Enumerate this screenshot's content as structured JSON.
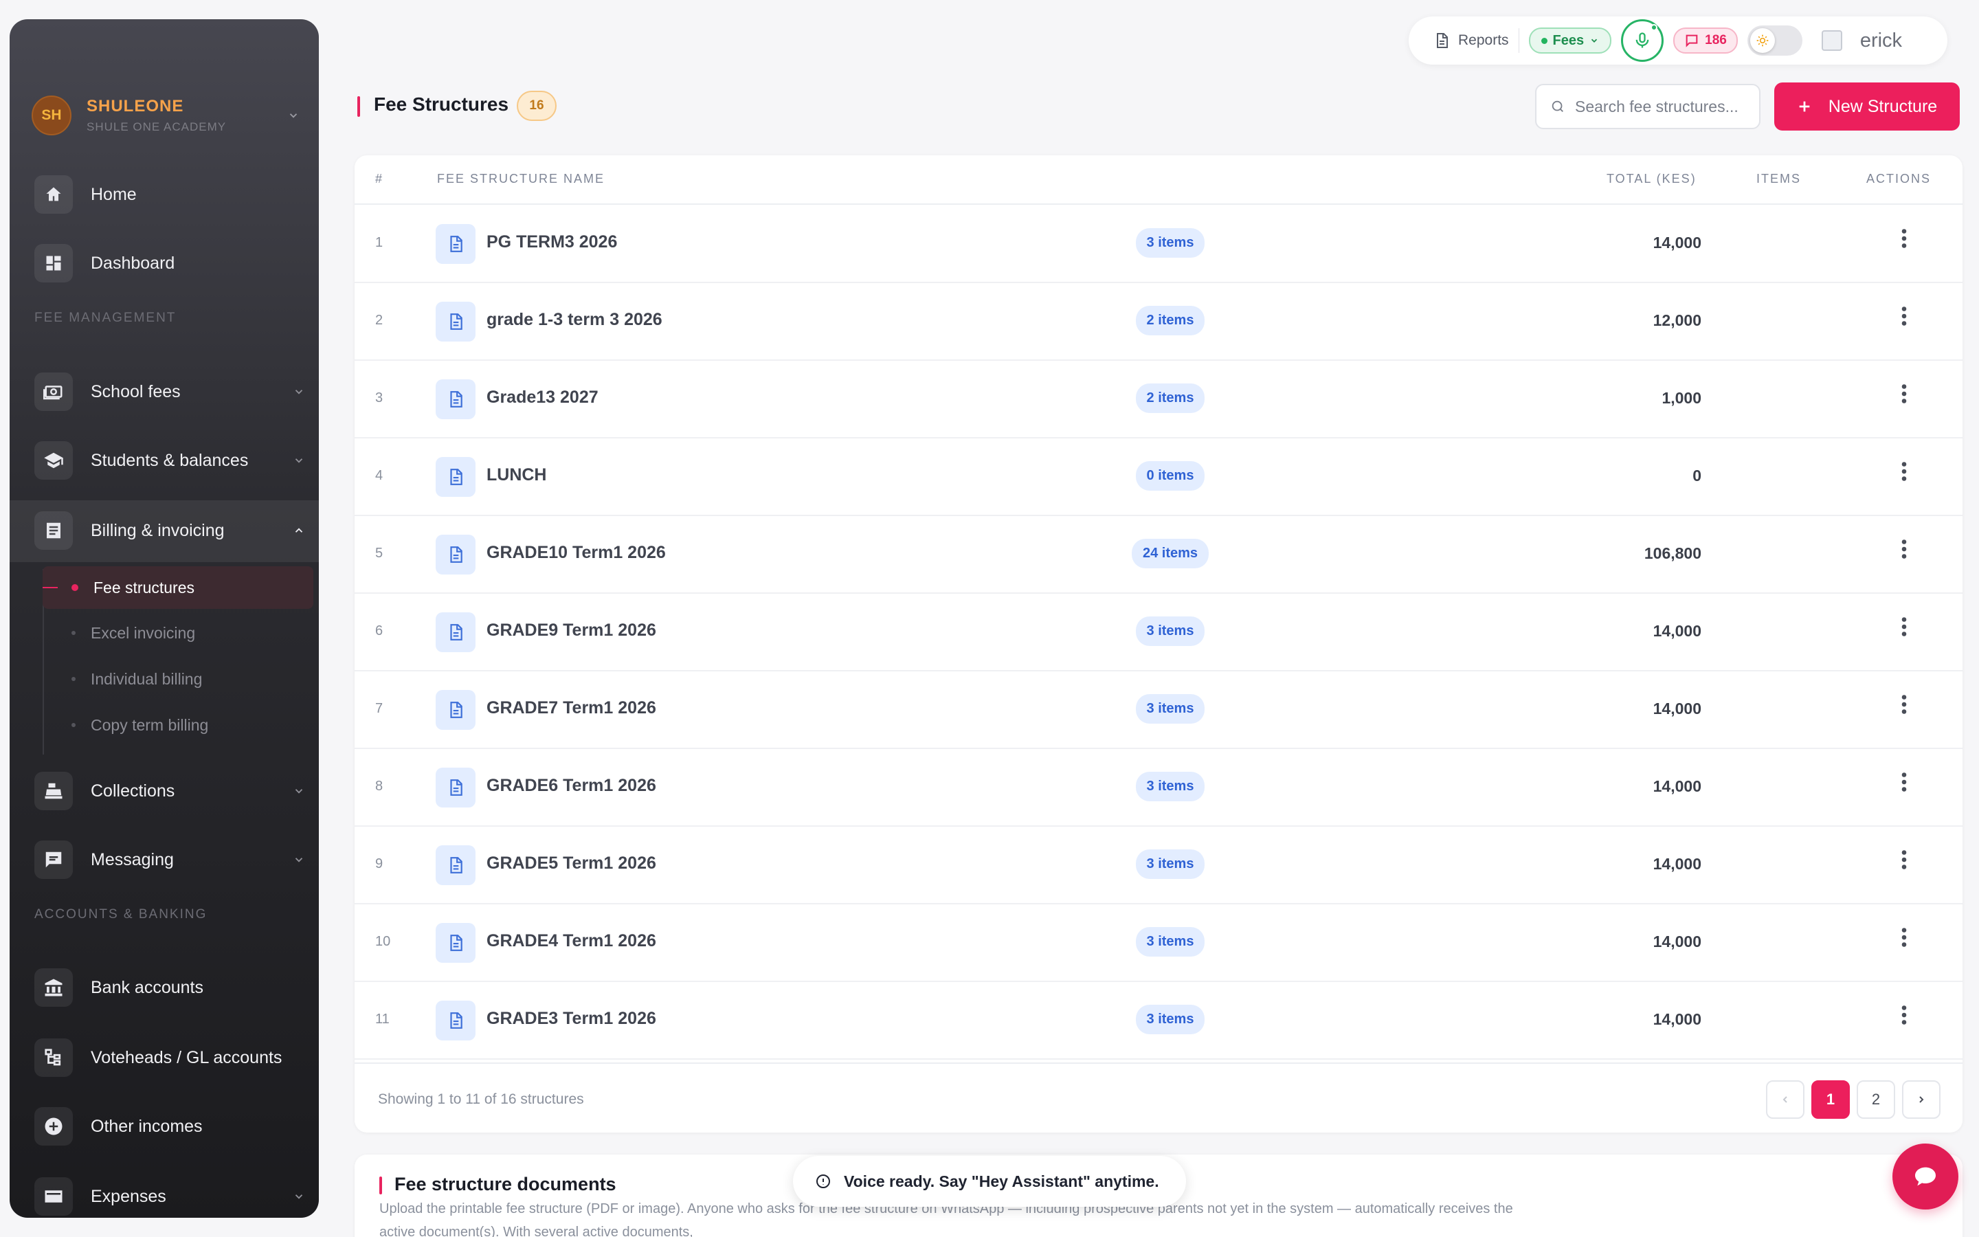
{
  "sidebar": {
    "brand": {
      "initials": "SH",
      "name": "SHULEONE",
      "subtitle": "SHULE ONE ACADEMY"
    },
    "items_top": [
      {
        "label": "Home",
        "icon": "home-icon"
      },
      {
        "label": "Dashboard",
        "icon": "dashboard-icon"
      }
    ],
    "section_fee": "FEE MANAGEMENT",
    "fee_items": [
      {
        "label": "School fees",
        "icon": "money-icon"
      },
      {
        "label": "Students & balances",
        "icon": "graduation-cap-icon"
      },
      {
        "label": "Billing & invoicing",
        "icon": "receipt-icon"
      }
    ],
    "billing_sub": [
      "Fee structures",
      "Excel invoicing",
      "Individual billing",
      "Copy term billing"
    ],
    "fee_items_after": [
      {
        "label": "Collections",
        "icon": "cash-register-icon"
      },
      {
        "label": "Messaging",
        "icon": "message-icon"
      }
    ],
    "section_accounts": "ACCOUNTS & BANKING",
    "account_items": [
      {
        "label": "Bank accounts",
        "icon": "bank-icon"
      },
      {
        "label": "Voteheads / GL accounts",
        "icon": "tree-icon"
      },
      {
        "label": "Other incomes",
        "icon": "plus-circle-icon"
      },
      {
        "label": "Expenses",
        "icon": "card-icon"
      }
    ]
  },
  "topbar": {
    "reports": "Reports",
    "fees": "Fees",
    "messages_count": "186",
    "user": "erick"
  },
  "header": {
    "title": "Fee Structures",
    "count": "16",
    "search_placeholder": "Search fee structures...",
    "new_button": "New Structure"
  },
  "table": {
    "columns": [
      "#",
      "FEE STRUCTURE NAME",
      "TOTAL (KES)",
      "ITEMS",
      "ACTIONS"
    ],
    "rows": [
      {
        "num": "1",
        "name": "PG TERM3 2026",
        "total": "14,000",
        "items": "3 items"
      },
      {
        "num": "2",
        "name": "grade 1-3 term 3 2026",
        "total": "12,000",
        "items": "2 items"
      },
      {
        "num": "3",
        "name": "Grade13 2027",
        "total": "1,000",
        "items": "2 items"
      },
      {
        "num": "4",
        "name": "LUNCH",
        "total": "0",
        "items": "0 items"
      },
      {
        "num": "5",
        "name": "GRADE10 Term1 2026",
        "total": "106,800",
        "items": "24 items"
      },
      {
        "num": "6",
        "name": "GRADE9 Term1 2026",
        "total": "14,000",
        "items": "3 items"
      },
      {
        "num": "7",
        "name": "GRADE7 Term1 2026",
        "total": "14,000",
        "items": "3 items"
      },
      {
        "num": "8",
        "name": "GRADE6 Term1 2026",
        "total": "14,000",
        "items": "3 items"
      },
      {
        "num": "9",
        "name": "GRADE5 Term1 2026",
        "total": "14,000",
        "items": "3 items"
      },
      {
        "num": "10",
        "name": "GRADE4 Term1 2026",
        "total": "14,000",
        "items": "3 items"
      },
      {
        "num": "11",
        "name": "GRADE3 Term1 2026",
        "total": "14,000",
        "items": "3 items"
      }
    ],
    "footer": "Showing 1 to 11 of 16 structures",
    "pages": [
      "1",
      "2"
    ],
    "current_page": "1"
  },
  "docs": {
    "title": "Fee structure documents",
    "description": "Upload the printable fee structure (PDF or image). Anyone who asks for the fee structure on WhatsApp — including prospective parents not yet in the system — automatically receives the active document(s). With several active documents,"
  },
  "toast": {
    "text": "Voice ready. Say \"Hey Assistant\" anytime."
  },
  "colors": {
    "accent": "#ec1f5c",
    "sidebar": "#2c2c31",
    "success": "#27b466",
    "items_blue": "#2f62d4"
  }
}
